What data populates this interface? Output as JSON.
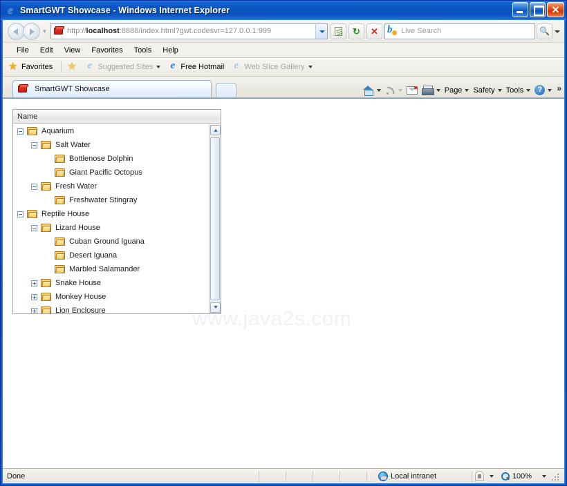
{
  "window": {
    "title": "SmartGWT Showcase - Windows Internet Explorer",
    "minimize_label": "Minimize",
    "maximize_label": "Maximize",
    "close_label": "Close"
  },
  "navigation": {
    "back_label": "Back",
    "forward_label": "Forward",
    "recent_pages_label": "Recent Pages",
    "url_display_prefix": "http://",
    "url_host": "localhost",
    "url_suffix": ":8888/index.html?gwt.codesvr=127.0.0.1:999",
    "url_full": "http://localhost:8888/index.html?gwt.codesvr=127.0.0.1:999",
    "compatibility_label": "Compatibility View",
    "refresh_label": "Refresh",
    "stop_label": "Stop",
    "refresh_glyph": "↻",
    "stop_glyph": "✕"
  },
  "search": {
    "placeholder": "Live Search",
    "provider": "Bing",
    "go_label": "Search",
    "options_label": "Search Options"
  },
  "menu": {
    "items": [
      {
        "label": "File"
      },
      {
        "label": "Edit"
      },
      {
        "label": "View"
      },
      {
        "label": "Favorites"
      },
      {
        "label": "Tools"
      },
      {
        "label": "Help"
      }
    ]
  },
  "favorites_bar": {
    "favorites_label": "Favorites",
    "add_to_favorites_label": "Add to Favorites Bar",
    "items": [
      {
        "label": "Suggested Sites",
        "dimmed": true,
        "has_caret": true
      },
      {
        "label": "Free Hotmail",
        "dimmed": false,
        "has_caret": false
      },
      {
        "label": "Web Slice Gallery",
        "dimmed": true,
        "has_caret": true
      }
    ]
  },
  "tabs": {
    "items": [
      {
        "label": "SmartGWT Showcase",
        "active": true
      }
    ],
    "new_tab_label": "New Tab"
  },
  "command_bar": {
    "home_label": "Home",
    "feeds_label": "Feeds",
    "mail_label": "Read Mail",
    "print_label": "Print",
    "items": [
      {
        "label": "Page"
      },
      {
        "label": "Safety"
      },
      {
        "label": "Tools"
      }
    ],
    "help_label": "Help",
    "overflow_label": "»"
  },
  "page": {
    "watermark": "www.java2s.com"
  },
  "tree_grid": {
    "column_header": "Name",
    "rows": [
      {
        "label": "Aquarium",
        "depth": 0,
        "state": "expanded"
      },
      {
        "label": "Salt Water",
        "depth": 1,
        "state": "expanded"
      },
      {
        "label": "Bottlenose Dolphin",
        "depth": 2,
        "state": "leaf"
      },
      {
        "label": "Giant Pacific Octopus",
        "depth": 2,
        "state": "leaf"
      },
      {
        "label": "Fresh Water",
        "depth": 1,
        "state": "expanded"
      },
      {
        "label": "Freshwater Stingray",
        "depth": 2,
        "state": "leaf"
      },
      {
        "label": "Reptile House",
        "depth": 0,
        "state": "expanded"
      },
      {
        "label": "Lizard House",
        "depth": 1,
        "state": "expanded"
      },
      {
        "label": "Cuban Ground Iguana",
        "depth": 2,
        "state": "leaf"
      },
      {
        "label": "Desert Iguana",
        "depth": 2,
        "state": "leaf"
      },
      {
        "label": "Marbled Salamander",
        "depth": 2,
        "state": "leaf"
      },
      {
        "label": "Snake House",
        "depth": 1,
        "state": "collapsed"
      },
      {
        "label": "Monkey House",
        "depth": 1,
        "state": "collapsed"
      },
      {
        "label": "Lion Enclosure",
        "depth": 1,
        "state": "collapsed"
      }
    ],
    "scroll_up_label": "Scroll Up",
    "scroll_down_label": "Scroll Down"
  },
  "status_bar": {
    "status_text": "Done",
    "zone_label": "Local intranet",
    "protected_mode_label": "Protected Mode",
    "zoom_level": "100%"
  },
  "colors": {
    "title_blue": "#0A56C4",
    "folder_gold": "#F7CE62",
    "accent_border": "#9AB2CB",
    "watermark_gray": "#EEF1F6"
  }
}
